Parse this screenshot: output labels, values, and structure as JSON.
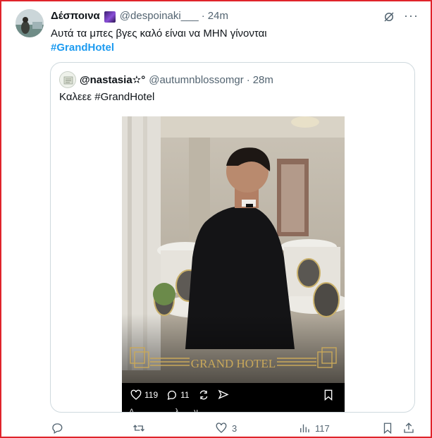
{
  "author": {
    "name": "Δέσποινα",
    "handle": "@despoinaki___",
    "separator": "·",
    "time": "24m",
    "text": "Αυτά τα μπες βγες καλό είναι να ΜΗΝ γίνονται",
    "hashtag": "#GrandHotel"
  },
  "quoted": {
    "name": "@nastasia✫°",
    "handle": "@autumnblossomgr",
    "separator": "·",
    "time": "28m",
    "text": "Καλεεε #GrandHotel",
    "media": {
      "logo_text": "GRAND HOTEL",
      "likes": "119",
      "comments": "11",
      "caption_partial": "Δ... ... ... ... ...λ... ...ν"
    }
  },
  "actions": {
    "reply_count": "",
    "retweet_count": "",
    "like_count": "3",
    "views_count": "117"
  },
  "icons": [
    "grok-icon",
    "more-icon",
    "reply-icon",
    "retweet-icon",
    "like-icon",
    "views-icon",
    "bookmark-icon",
    "share-icon"
  ],
  "colors": {
    "accent": "#1d9bf0",
    "text": "#0f1419",
    "muted": "#536471",
    "border": "#cfd9de",
    "frame": "#e0242b"
  }
}
